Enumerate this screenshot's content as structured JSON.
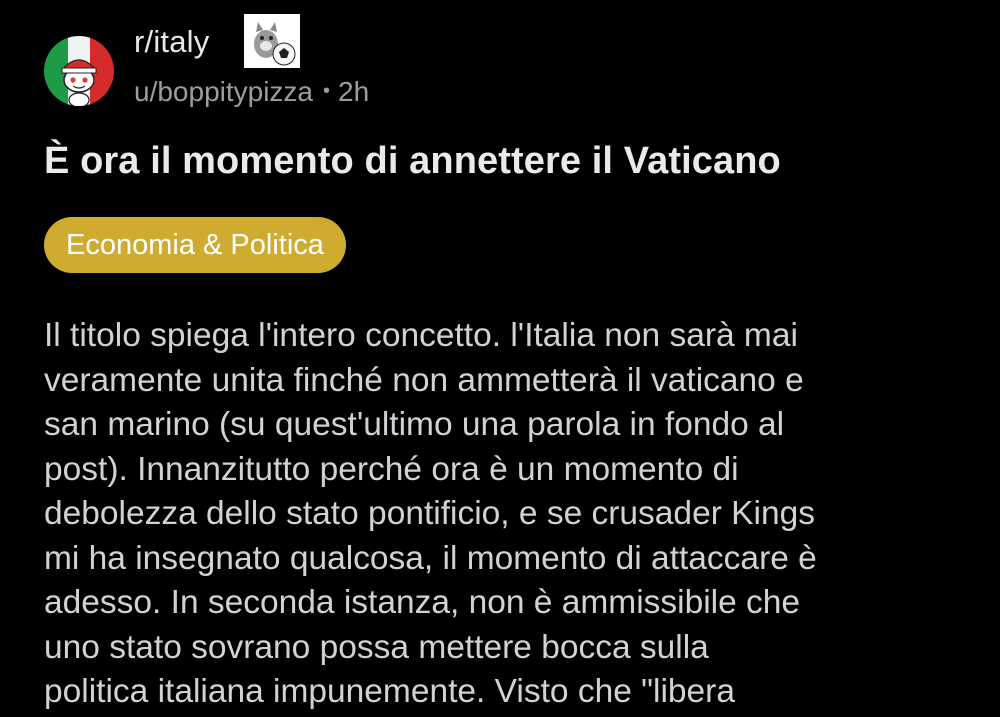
{
  "post": {
    "subreddit": "r/italy",
    "author": "u/boppitypizza",
    "separator": "•",
    "age": "2h",
    "title": "È ora il momento di annettere il Vaticano",
    "flair": {
      "label": "Economia & Politica",
      "color": "#cfac2f"
    },
    "body_lines": [
      "Il titolo spiega l'intero concetto. l'Italia non sarà mai",
      "veramente unita finché non ammetterà il vaticano e",
      "san marino (su quest'ultimo una parola in fondo al",
      "post). Innanzitutto perché ora è un momento di",
      "debolezza dello stato pontificio, e se crusader Kings",
      "mi ha insegnato qualcosa, il momento di attaccare è",
      "adesso. In seconda istanza, non è ammissibile che",
      "uno stato sovrano possa mettere bocca sulla",
      "politica italiana impunemente. Visto che \"libera"
    ]
  },
  "icons": {
    "community_avatar": "italy-snoo-avatar",
    "user_flair": "kitten-soccer-ball-image"
  },
  "colors": {
    "background": "#000000",
    "flair_bg": "#cfac2f",
    "meta_text": "#9a9ea2"
  }
}
